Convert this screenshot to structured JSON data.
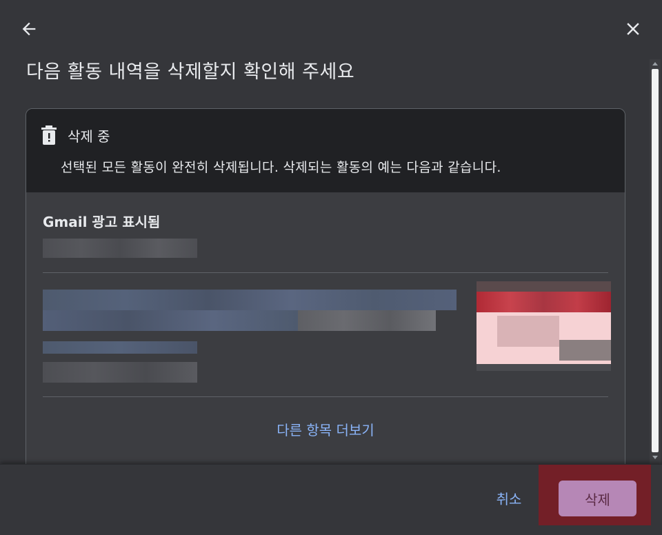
{
  "header": {
    "back_icon": "arrow-left-icon",
    "close_icon": "close-icon",
    "title": "다음 활동 내역을 삭제할지 확인해 주세요"
  },
  "notice": {
    "icon": "trash-icon",
    "title": "삭제 중",
    "description": "선택된 모든 활동이 완전히 삭제됩니다. 삭제되는 활동의 예는 다음과 같습니다."
  },
  "activity": {
    "section_title": "Gmail 광고 표시됨",
    "more_link": "다른 항목 더보기"
  },
  "footer": {
    "cancel_label": "취소",
    "delete_label": "삭제"
  },
  "colors": {
    "background": "#35363a",
    "card_header": "#202124",
    "link": "#8ab4f8",
    "delete_button": "#b687b6",
    "delete_highlight": "#731f27"
  }
}
